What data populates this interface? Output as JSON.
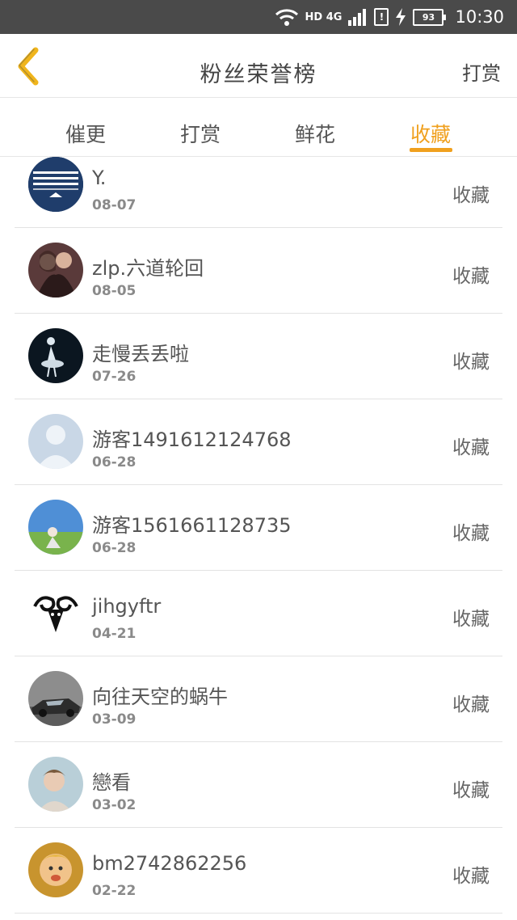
{
  "status_bar": {
    "network": "HD 4G",
    "battery": "93",
    "time": "10:30",
    "icons": [
      "wifi-icon",
      "signal-icon",
      "sim-alert-icon",
      "charging-icon",
      "battery-icon"
    ]
  },
  "header": {
    "back_icon": "chevron-left-icon",
    "title": "粉丝荣誉榜",
    "action": "打赏"
  },
  "tabs": [
    {
      "label": "催更",
      "active": false
    },
    {
      "label": "打赏",
      "active": false
    },
    {
      "label": "鲜花",
      "active": false
    },
    {
      "label": "收藏",
      "active": true
    }
  ],
  "colors": {
    "accent": "#f0a01e",
    "status_bar": "#4a4a4a"
  },
  "list": [
    {
      "name": "Y.",
      "date": "08-07",
      "action": "收藏"
    },
    {
      "name": "zlp.六道轮回",
      "date": "08-05",
      "action": "收藏"
    },
    {
      "name": "走慢丢丢啦",
      "date": "07-26",
      "action": "收藏"
    },
    {
      "name": "游客1491612124768",
      "date": "06-28",
      "action": "收藏"
    },
    {
      "name": "游客1561661128735",
      "date": "06-28",
      "action": "收藏"
    },
    {
      "name": "jihgyftr",
      "date": "04-21",
      "action": "收藏"
    },
    {
      "name": "向往天空的蜗牛",
      "date": "03-09",
      "action": "收藏"
    },
    {
      "name": "戀看",
      "date": "03-02",
      "action": "收藏"
    },
    {
      "name": "bm2742862256",
      "date": "02-22",
      "action": "收藏"
    }
  ]
}
